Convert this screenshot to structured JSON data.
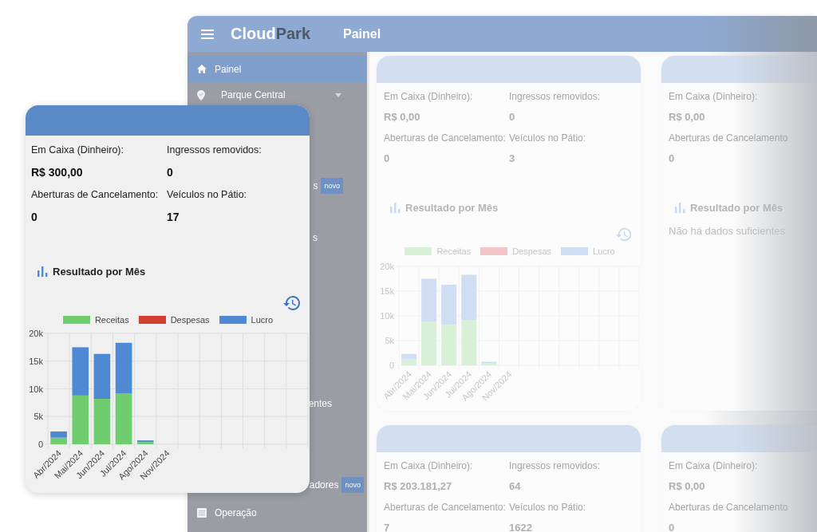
{
  "header": {
    "logo_primary": "Cloud",
    "logo_secondary": "Park",
    "title": "Painel"
  },
  "sidebar": {
    "items": [
      {
        "kind": "home",
        "label": "Painel",
        "selected": true
      },
      {
        "kind": "select",
        "label": "Parque Central",
        "selected": false
      },
      {
        "kind": "fragment",
        "label": "s",
        "badge": "novo",
        "selected": false
      },
      {
        "kind": "fragment",
        "label": "s",
        "selected": false
      },
      {
        "kind": "fragment",
        "label": "entes",
        "selected": false
      },
      {
        "kind": "fragment",
        "label": "adores",
        "badge": "novo",
        "selected": false
      },
      {
        "kind": "list",
        "label": "Operação",
        "selected": false
      }
    ]
  },
  "cards": [
    {
      "columns": [
        [
          {
            "label": "Em Caixa (Dinheiro):",
            "value": "R$ 0,00"
          },
          {
            "label": "Aberturas de Cancelamento:",
            "value": "0"
          }
        ],
        [
          {
            "label": "Ingressos removidos:",
            "value": "0"
          },
          {
            "label": "Veículos no Pátio:",
            "value": "3"
          }
        ]
      ],
      "chart_title": "Resultado por Mês",
      "chart_data": {
        "type": "bar",
        "stacked": true,
        "grid": true,
        "categories": [
          "Abr/2024",
          "Mai/2024",
          "Jun/2024",
          "Jul/2024",
          "Ago/2024",
          "Nov/2024"
        ],
        "ylim": [
          0,
          20000
        ],
        "yticks": [
          {
            "value": 0,
            "label": "0"
          },
          {
            "value": 5000,
            "label": "5k"
          },
          {
            "value": 10000,
            "label": "10k"
          },
          {
            "value": 15000,
            "label": "15k"
          },
          {
            "value": 20000,
            "label": "20k"
          }
        ],
        "series": [
          {
            "name": "Receitas",
            "color": "#d8efd8",
            "values": [
              1200,
              8800,
              8200,
              9200,
              400,
              0
            ]
          },
          {
            "name": "Despesas",
            "color": "#f2c6c6",
            "values": [
              0,
              0,
              0,
              0,
              0,
              0
            ]
          },
          {
            "name": "Lucro",
            "color": "#cfdef2",
            "values": [
              1100,
              8700,
              8100,
              9100,
              300,
              0
            ]
          }
        ]
      }
    },
    {
      "columns": [
        [
          {
            "label": "Em Caixa (Dinheiro):",
            "value": "R$ 0,00"
          },
          {
            "label": "Aberturas de Cancelamento",
            "value": "0"
          }
        ]
      ],
      "chart_title": "Resultado por Mês",
      "empty_message": "Não há dados suficientes"
    },
    {
      "columns": [
        [
          {
            "label": "Em Caixa (Dinheiro):",
            "value": "R$ 203.181,27"
          },
          {
            "label": "Aberturas de Cancelamento:",
            "value": "7"
          }
        ],
        [
          {
            "label": "Ingressos removidos:",
            "value": "64"
          },
          {
            "label": "Veículos no Pátio:",
            "value": "1622"
          }
        ]
      ]
    },
    {
      "columns": [
        [
          {
            "label": "Em Caixa (Dinheiro):",
            "value": "R$ 0,00"
          },
          {
            "label": "Aberturas de Cancelamento",
            "value": "0"
          }
        ]
      ]
    }
  ],
  "featured_card": {
    "columns": [
      [
        {
          "label": "Em Caixa (Dinheiro):",
          "value": "R$ 300,00"
        },
        {
          "label": "Aberturas de Cancelamento:",
          "value": "0"
        }
      ],
      [
        {
          "label": "Ingressos removidos:",
          "value": "0"
        },
        {
          "label": "Veículos no Pátio:",
          "value": "17"
        }
      ]
    ],
    "chart_title": "Resultado por Mês",
    "chart_data": {
      "type": "bar",
      "stacked": true,
      "grid": true,
      "categories": [
        "Abr/2024",
        "Mai/2024",
        "Jun/2024",
        "Jul/2024",
        "Ago/2024",
        "Nov/2024"
      ],
      "ylim": [
        0,
        20000
      ],
      "yticks": [
        {
          "value": 0,
          "label": "0"
        },
        {
          "value": 5000,
          "label": "5k"
        },
        {
          "value": 10000,
          "label": "10k"
        },
        {
          "value": 15000,
          "label": "15k"
        },
        {
          "value": 20000,
          "label": "20k"
        }
      ],
      "series": [
        {
          "name": "Receitas",
          "color": "#6fcd6f",
          "values": [
            1200,
            8800,
            8200,
            9200,
            400,
            0
          ]
        },
        {
          "name": "Despesas",
          "color": "#d4402e",
          "values": [
            0,
            0,
            0,
            0,
            0,
            0
          ]
        },
        {
          "name": "Lucro",
          "color": "#4f89d4",
          "values": [
            1100,
            8700,
            8100,
            9100,
            300,
            0
          ]
        }
      ]
    }
  }
}
